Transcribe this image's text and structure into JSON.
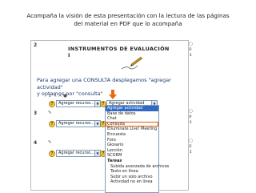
{
  "caption": {
    "line1": "Acompaña la visión de esta presentación con la lectura de las páginas",
    "line2": "del material en PDF que lo acompaña"
  },
  "section2": {
    "number": "2",
    "title": "INSTRUMENTOS DE EVALUACIÓN I"
  },
  "callout": {
    "line1": "Para agregar una  CONSULTA desplegamos \"agregar actividad\"",
    "line2": "y optamos por \"consulta\""
  },
  "rows": [
    {
      "add_resource": "Agregar recurso...",
      "add_activity": "Agregar actividad"
    },
    {
      "add_resource": "Agregar recurso..."
    },
    {
      "add_resource": "Agregar recurso..."
    }
  ],
  "section3": {
    "number": "3"
  },
  "section4": {
    "number": "4"
  },
  "dropdown": {
    "items": [
      {
        "label": "Agregar actividad",
        "state": "highlight"
      },
      {
        "label": "Base de datos"
      },
      {
        "label": "Chat"
      },
      {
        "label": "Consulta",
        "state": "marked"
      },
      {
        "label": "Elluminate Live! Meeting"
      },
      {
        "label": "Encuesta"
      },
      {
        "label": "Foro"
      },
      {
        "label": "Glosario"
      },
      {
        "label": "Lección"
      },
      {
        "label": "SCORM"
      },
      {
        "label": "Tareas",
        "state": "group"
      },
      {
        "label": "Subida avanzada de archivos",
        "state": "sub"
      },
      {
        "label": "Texto en línea",
        "state": "sub"
      },
      {
        "label": "Subir un solo archivo",
        "state": "sub"
      },
      {
        "label": "Actividad no en línea",
        "state": "sub"
      }
    ]
  },
  "colors": {
    "highlight": "#316ac5",
    "marker": "#e05a00",
    "callout_text": "#1c3c6e"
  },
  "icons": [
    "help-icon",
    "move-icon",
    "edit-icon",
    "eye-icon",
    "arrow-down-icon"
  ]
}
